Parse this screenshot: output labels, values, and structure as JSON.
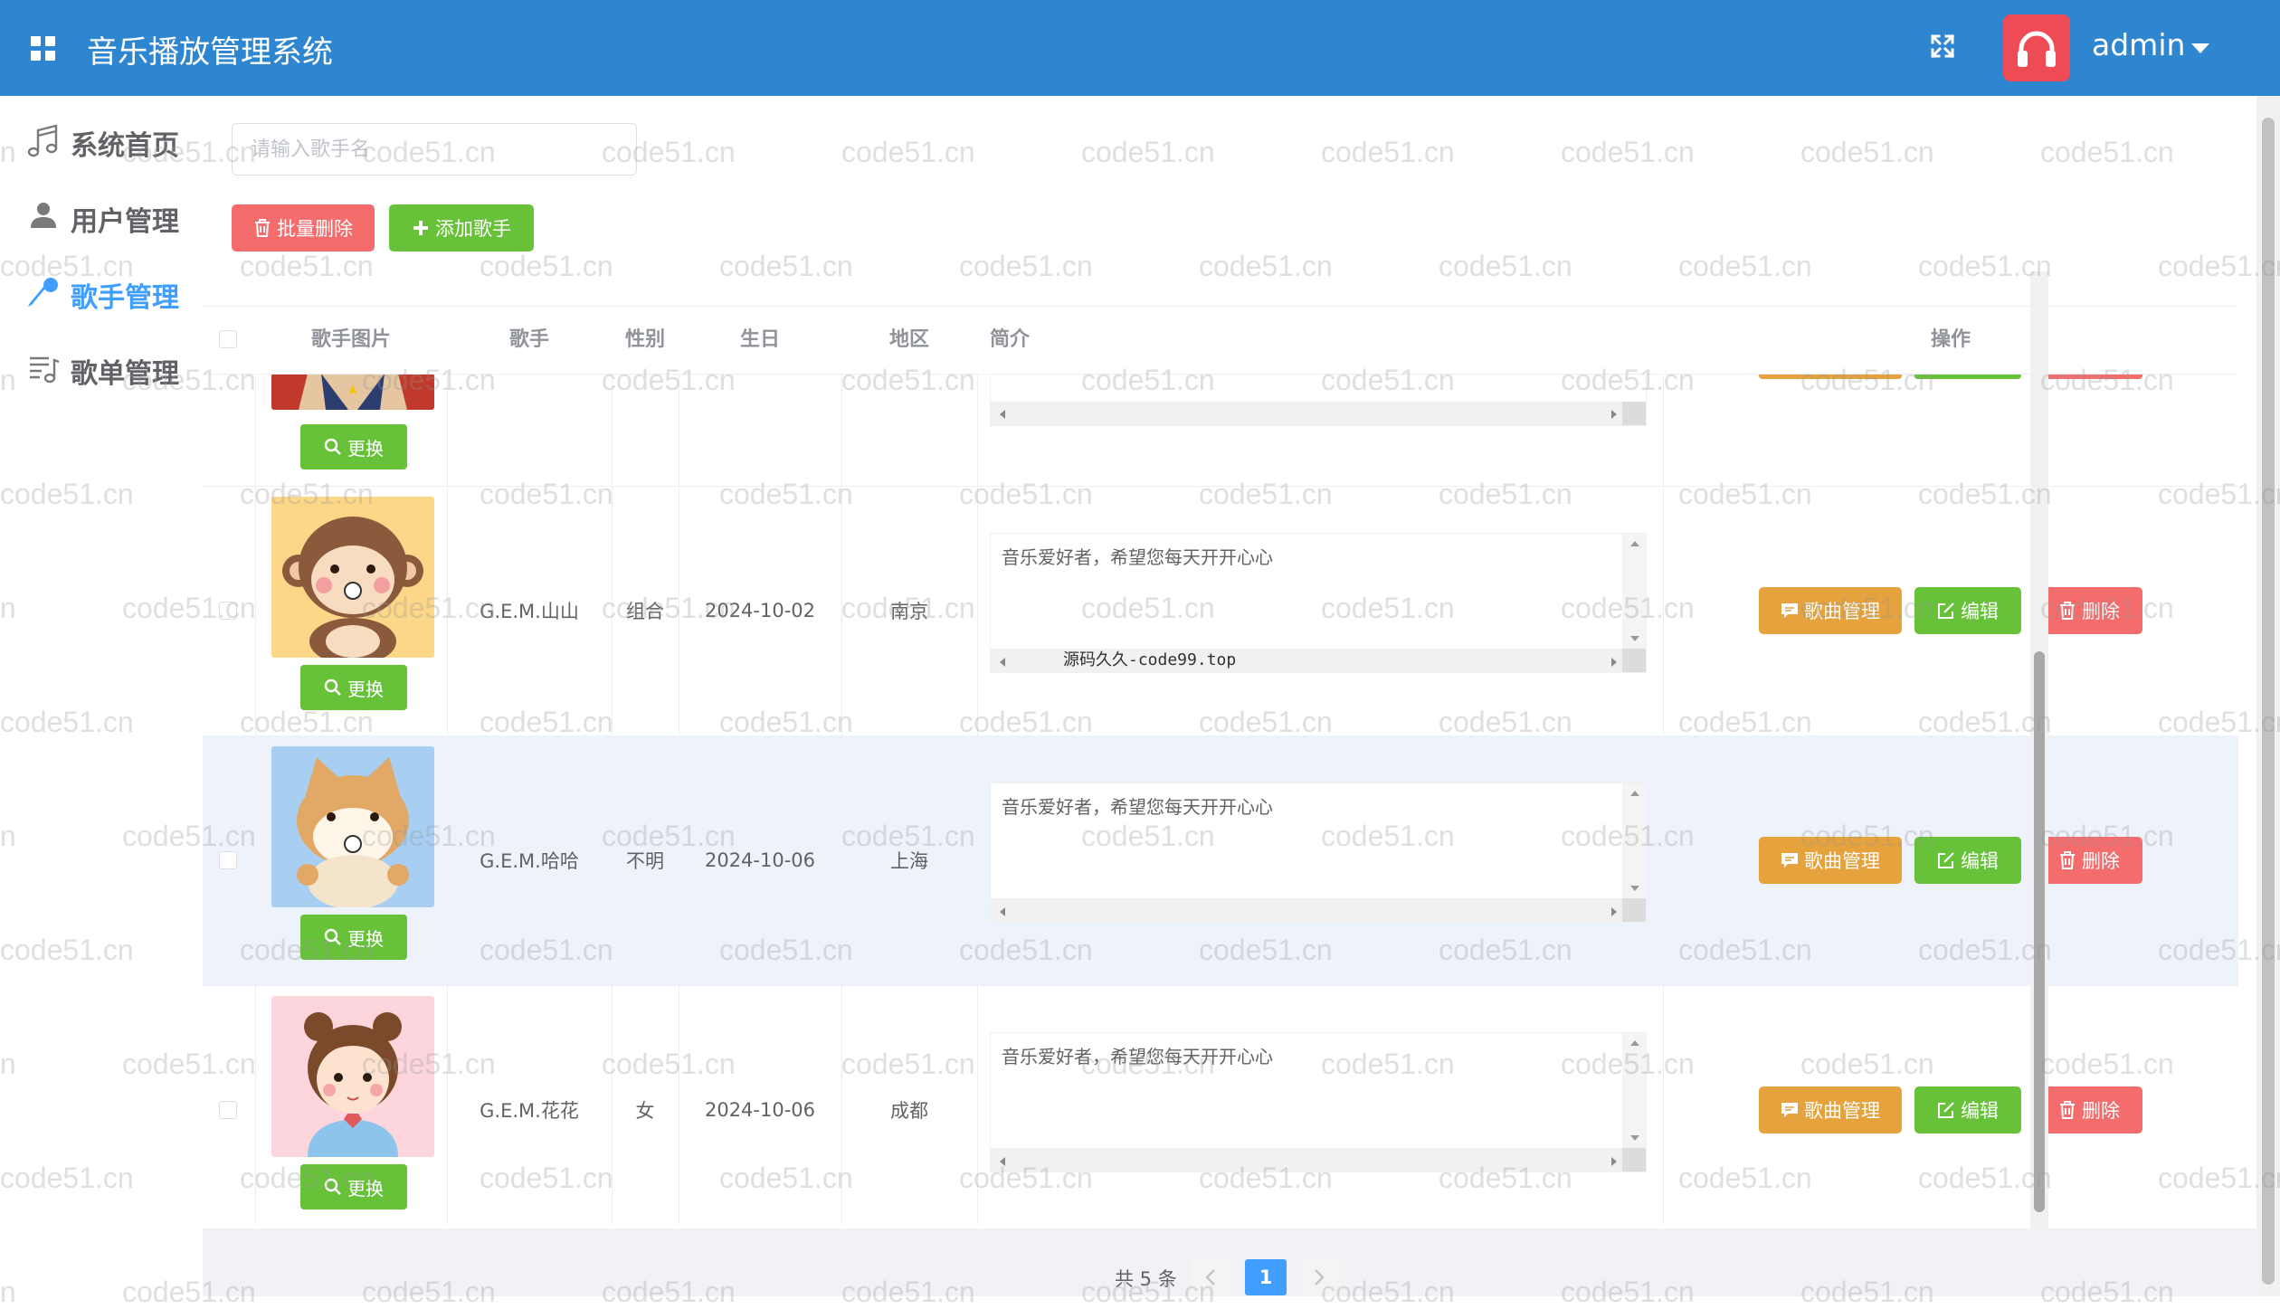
{
  "header": {
    "app_title": "音乐播放管理系统",
    "user_name": "admin",
    "colors": {
      "header_bg": "#2e85d0",
      "avatar_bg": "#ef4b57"
    },
    "icons": {
      "menu": "grid-icon",
      "fullscreen": "fullscreen-icon",
      "avatar": "headphones-icon",
      "dropdown": "caret-down-icon"
    }
  },
  "sidebar": {
    "items": [
      {
        "label": "系统首页",
        "icon": "music-note-icon",
        "active": false
      },
      {
        "label": "用户管理",
        "icon": "user-icon",
        "active": false
      },
      {
        "label": "歌手管理",
        "icon": "microphone-icon",
        "active": true
      },
      {
        "label": "歌单管理",
        "icon": "playlist-icon",
        "active": false
      }
    ]
  },
  "toolbar": {
    "search_placeholder": "请输入歌手名",
    "batch_delete_label": "批量删除",
    "add_singer_label": "添加歌手"
  },
  "table": {
    "columns": [
      "歌手图片",
      "歌手",
      "性别",
      "生日",
      "地区",
      "简介",
      "操作"
    ],
    "change_label": "更换",
    "action_labels": {
      "songs": "歌曲管理",
      "edit": "编辑",
      "delete": "删除"
    },
    "rows": [
      {
        "name": "G.E.M.山山",
        "sex": "组合",
        "birth": "2024-10-02",
        "location": "南京",
        "intro": "音乐爱好者，希望您每天开开心心",
        "image": "monkey-avatar",
        "scroll_text": "源码久久-code99.top"
      },
      {
        "name": "G.E.M.哈哈",
        "sex": "不明",
        "birth": "2024-10-06",
        "location": "上海",
        "intro": "音乐爱好者，希望您每天开开心心",
        "image": "shiba-avatar",
        "scroll_text": ""
      },
      {
        "name": "G.E.M.花花",
        "sex": "女",
        "birth": "2024-10-06",
        "location": "成都",
        "intro": "音乐爱好者，希望您每天开开心心",
        "image": "girl-avatar",
        "scroll_text": ""
      }
    ]
  },
  "pagination": {
    "total_text": "共 5 条",
    "current_page": "1",
    "prev_icon": "chevron-left-icon",
    "next_icon": "chevron-right-icon"
  },
  "watermark": "code51.cn"
}
